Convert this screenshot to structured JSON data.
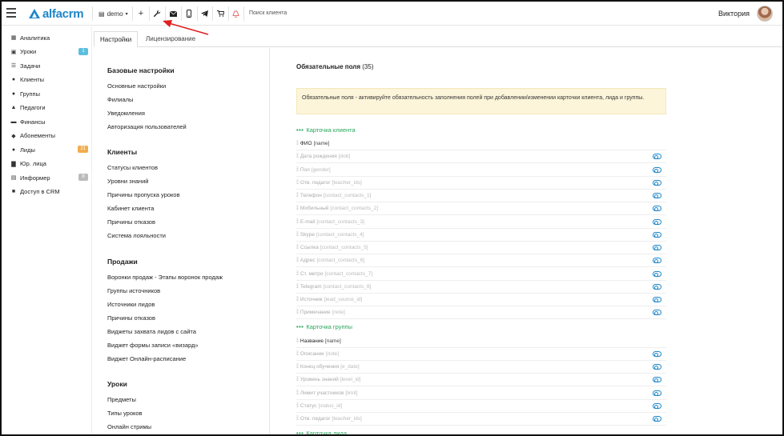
{
  "topbar": {
    "logo": "alfacrm",
    "branch": "demo",
    "search_label": "Поиск клиента",
    "user_name": "Виктория",
    "icons": [
      "plus-icon",
      "wrench-icon",
      "envelope-icon",
      "mobile-icon",
      "telegram-icon",
      "cart-icon",
      "bell-icon"
    ]
  },
  "sidebar": {
    "items": [
      {
        "label": "Аналитика",
        "icon": "dashboard-icon"
      },
      {
        "label": "Уроки",
        "icon": "calendar-icon",
        "badge": "1",
        "badge_color": "#5bc0de"
      },
      {
        "label": "Задачи",
        "icon": "tasks-icon"
      },
      {
        "label": "Клиенты",
        "icon": "user-icon"
      },
      {
        "label": "Группы",
        "icon": "users-icon"
      },
      {
        "label": "Педагоги",
        "icon": "graduation-icon"
      },
      {
        "label": "Финансы",
        "icon": "money-icon"
      },
      {
        "label": "Абонементы",
        "icon": "tag-icon"
      },
      {
        "label": "Лиды",
        "icon": "user-plus-icon",
        "badge": "21",
        "badge_color": "#f0ad4e"
      },
      {
        "label": "Юр. лица",
        "icon": "building-icon"
      },
      {
        "label": "Информер",
        "icon": "inbox-icon",
        "badge": "8",
        "badge_color": "#bbbbbb"
      },
      {
        "label": "Доступ в CRM",
        "icon": "lock-icon"
      }
    ]
  },
  "tabs": [
    "Настройки",
    "Лицензирование"
  ],
  "settings_nav": {
    "base_title": "Базовые настройки",
    "base": [
      "Основные настройки",
      "Филиалы",
      "Уведомления",
      "Авторизация пользователей"
    ],
    "clients_title": "Клиенты",
    "clients": [
      "Статусы клиентов",
      "Уровни знаний",
      "Причины пропуска уроков",
      "Кабинет клиента",
      "Причины отказов",
      "Система лояльности"
    ],
    "sales_title": "Продажи",
    "sales": [
      "Воронки продаж - Этапы воронок продаж",
      "Группы источников",
      "Источники лидов",
      "Причины отказов",
      "Виджеты захвата лидов с сайта",
      "Виджет формы записи «визард»",
      "Виджет Онлайн-расписание"
    ],
    "lessons_title": "Уроки",
    "lessons": [
      "Предметы",
      "Типы уроков",
      "Онлайн стримы"
    ]
  },
  "content": {
    "title": "Обязательные поля",
    "count": "(35)",
    "alert": "Обязательные поля - активируйте обязательность заполнения полей при добавлении/изменении карточки клиента, лида и группы.",
    "drag_glyph": "⁞⁞",
    "section_dots": "•••",
    "sections": [
      {
        "title": "Карточка клиента",
        "fields": [
          {
            "name": "ФИО",
            "key": "[name]",
            "required": true
          },
          {
            "name": "Дата рождения",
            "key": "[dob]",
            "required": false
          },
          {
            "name": "Пол",
            "key": "[gender]",
            "required": false
          },
          {
            "name": "Отв. педагог",
            "key": "[teacher_ids]",
            "required": false
          },
          {
            "name": "Телефон",
            "key": "[contact_contacts_1]",
            "required": false
          },
          {
            "name": "Мобильный",
            "key": "[contact_contacts_2]",
            "required": false
          },
          {
            "name": "E-mail",
            "key": "[contact_contacts_3]",
            "required": false
          },
          {
            "name": "Skype",
            "key": "[contact_contacts_4]",
            "required": false
          },
          {
            "name": "Ссылка",
            "key": "[contact_contacts_5]",
            "required": false
          },
          {
            "name": "Адрес",
            "key": "[contact_contacts_6]",
            "required": false
          },
          {
            "name": "Ст. метро",
            "key": "[contact_contacts_7]",
            "required": false
          },
          {
            "name": "Telegram",
            "key": "[contact_contacts_8]",
            "required": false
          },
          {
            "name": "Источник",
            "key": "[lead_source_id]",
            "required": false
          },
          {
            "name": "Примечание",
            "key": "[note]",
            "required": false
          }
        ]
      },
      {
        "title": "Карточка группы",
        "fields": [
          {
            "name": "Название",
            "key": "[name]",
            "required": true
          },
          {
            "name": "Описание",
            "key": "[note]",
            "required": false
          },
          {
            "name": "Конец обучения",
            "key": "[e_date]",
            "required": false
          },
          {
            "name": "Уровень знаний",
            "key": "[level_id]",
            "required": false
          },
          {
            "name": "Лимит участников",
            "key": "[limit]",
            "required": false
          },
          {
            "name": "Статус",
            "key": "[status_id]",
            "required": false
          },
          {
            "name": "Отв. педагог",
            "key": "[teacher_ids]",
            "required": false
          }
        ]
      },
      {
        "title": "Карточка лида",
        "fields": []
      }
    ]
  },
  "colors": {
    "accent": "#1d86c9",
    "section": "#27a65a",
    "arrow": "#e02020"
  }
}
